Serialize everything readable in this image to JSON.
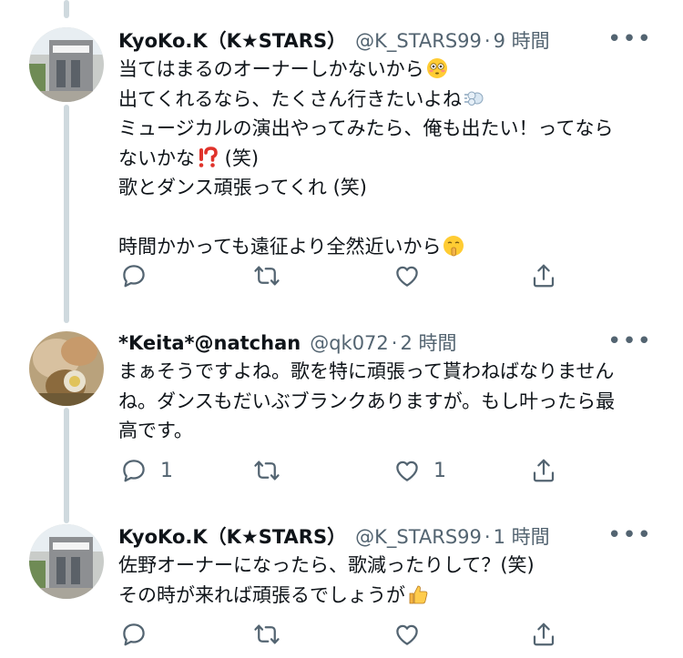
{
  "tweets": [
    {
      "name": "KyoKo.K（K★STARS）",
      "handle": "@K_STARS99",
      "sep": "·",
      "time": "9 時間",
      "more": "•••",
      "lines": [
        "当てはまるのオーナーしかないから",
        "出てくれるなら、たくさん行きたいよね",
        "ミュージカルの演出やってみたら、俺も出たい！ってなら",
        "ないかな",
        " (笑)",
        "歌とダンス頑張ってくれ (笑)",
        "時間かかっても遠征より全然近いから"
      ],
      "emojis": [
        "flushed-face",
        "dashing-away",
        "exclamation-question-mark",
        "shushing-face"
      ],
      "reply_count": "",
      "like_count": ""
    },
    {
      "name": "*Keita*@natchan",
      "handle": "@qk072",
      "sep": "·",
      "time": "2 時間",
      "more": "•••",
      "lines": [
        "まぁそうですよね。歌を特に頑張って貰わねばなりません",
        "ね。ダンスもだいぶブランクありますが。もし叶ったら最",
        "高です。"
      ],
      "reply_count": "1",
      "like_count": "1"
    },
    {
      "name": "KyoKo.K（K★STARS）",
      "handle": "@K_STARS99",
      "sep": "·",
      "time": "1 時間",
      "more": "•••",
      "lines": [
        "佐野オーナーになったら、歌減ったりして？(笑)",
        "その時が来れば頑張るでしょうが"
      ],
      "emojis": [
        "thumbs-up"
      ],
      "reply_count": "",
      "like_count": ""
    }
  ],
  "icons": [
    "reply-icon",
    "retweet-icon",
    "like-icon",
    "share-icon",
    "more-icon"
  ]
}
